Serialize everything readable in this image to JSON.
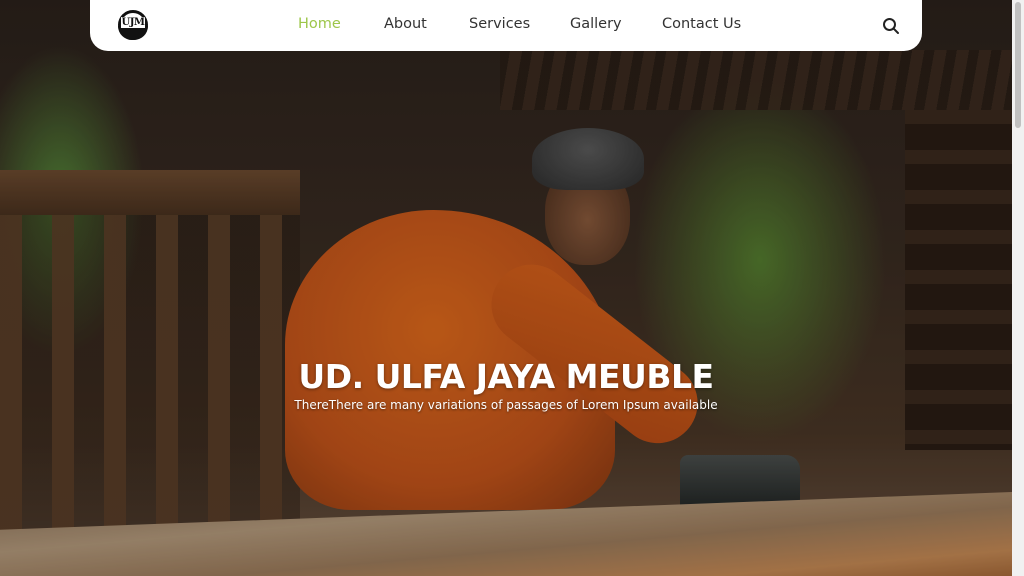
{
  "brand": {
    "logo_text": "UJM"
  },
  "nav": {
    "items": [
      {
        "label": "Home",
        "active": true
      },
      {
        "label": "About",
        "active": false
      },
      {
        "label": "Services",
        "active": false
      },
      {
        "label": "Gallery",
        "active": false
      },
      {
        "label": "Contact Us",
        "active": false
      }
    ],
    "search_icon": "search-icon"
  },
  "hero": {
    "title": "UD. ULFA JAYA MEUBLE",
    "subtitle": "ThereThere are many variations of passages of Lorem Ipsum available"
  },
  "colors": {
    "accent": "#9dc64a",
    "nav_text": "#333333",
    "nav_bg": "#ffffff"
  }
}
